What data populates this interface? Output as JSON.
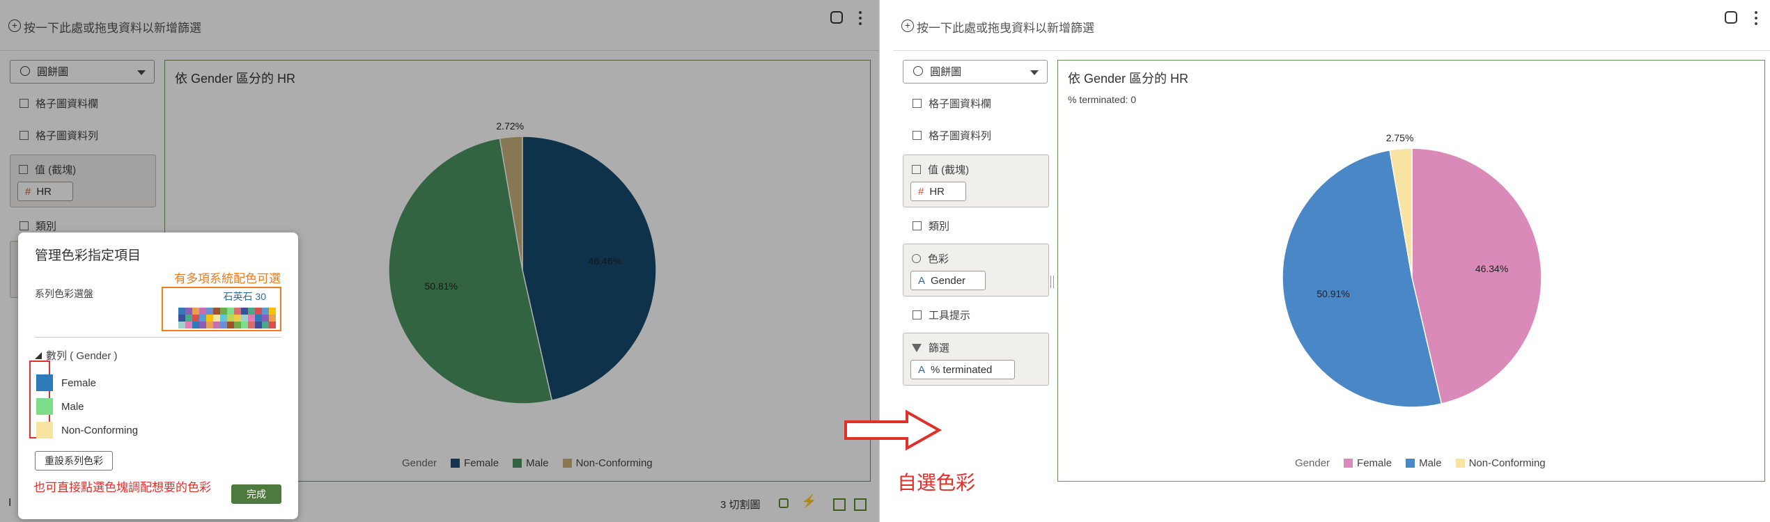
{
  "left": {
    "filter_placeholder": "按一下此處或拖曳資料以新增篩選",
    "chart_type": "圓餅圖",
    "side_items": {
      "grid_columns": "格子圖資料欄",
      "grid_rows": "格子圖資料列",
      "values_title": "值 (截塊)",
      "values_pill": "HR",
      "category": "類別"
    },
    "chart": {
      "title": "依 Gender 區分的 HR",
      "legend_title": "Gender",
      "legend": [
        "Female",
        "Male",
        "Non-Conforming"
      ]
    },
    "status": {
      "trellis": "3 切割圖",
      "peek_letter": "I"
    },
    "dialog": {
      "title": "管理色彩指定項目",
      "palette_label": "系列色彩選盤",
      "palette_name": "石英石 30",
      "section_label": "數列 ( Gender )",
      "items": [
        "Female",
        "Male",
        "Non-Conforming"
      ],
      "item_colors": [
        "#2f7ab8",
        "#7ddd8a",
        "#f8e3a1"
      ],
      "reset_button": "重設系列色彩",
      "done_button": "完成"
    },
    "notes": {
      "palette_note": "有多項系統配色可選",
      "click_note": "也可直接點選色塊調配想要的色彩"
    }
  },
  "arrow_label": "自選色彩",
  "right": {
    "filter_placeholder": "按一下此處或拖曳資料以新增篩選",
    "chart_type": "圓餅圖",
    "side_items": {
      "grid_columns": "格子圖資料欄",
      "grid_rows": "格子圖資料列",
      "values_title": "值 (截塊)",
      "values_pill": "HR",
      "category": "類別",
      "color_title": "色彩",
      "color_pill": "Gender",
      "tooltip": "工具提示",
      "filter_title": "篩選",
      "filter_pill": "% terminated"
    },
    "chart": {
      "title": "依 Gender 區分的 HR",
      "subtitle": "% terminated: 0",
      "legend_title": "Gender",
      "legend": [
        "Female",
        "Male",
        "Non-Conforming"
      ]
    }
  },
  "chart_data": [
    {
      "type": "pie",
      "title": "依 Gender 區分的 HR",
      "categories": [
        "Female",
        "Male",
        "Non-Conforming"
      ],
      "values": [
        46.46,
        50.81,
        2.72
      ],
      "labels": [
        "46.46%",
        "50.81%",
        "2.72%"
      ],
      "colors": [
        "#154a6e",
        "#4c9461",
        "#c8b07a"
      ],
      "legend_title": "Gender",
      "legend_position": "bottom"
    },
    {
      "type": "pie",
      "title": "依 Gender 區分的 HR",
      "subtitle": "% terminated: 0",
      "categories": [
        "Female",
        "Male",
        "Non-Conforming"
      ],
      "values": [
        46.34,
        50.91,
        2.75
      ],
      "labels": [
        "46.34%",
        "50.91%",
        "2.75%"
      ],
      "colors": [
        "#da8ab8",
        "#4a87c7",
        "#f9e3a3"
      ],
      "legend_title": "Gender",
      "legend_position": "bottom"
    }
  ],
  "legend_colors_left": [
    "#1f4e79",
    "#4c9461",
    "#c8b07a"
  ],
  "legend_colors_right": [
    "#da8ab8",
    "#4a87c7",
    "#f9e3a3"
  ],
  "palette_colors": [
    "#2f7ab8",
    "#7ddd8a",
    "#f8e3a1",
    "#8a5fb5",
    "#d96b6b",
    "#60c5d8",
    "#e8a04b",
    "#3b4f9a",
    "#b8d65a",
    "#c86fb0",
    "#4aa88a",
    "#f2c94c",
    "#6b8fd6",
    "#d94f4f",
    "#9cd3c8",
    "#a0522d",
    "#5b9bd5",
    "#e07bb4",
    "#70ad47",
    "#ffc000"
  ]
}
